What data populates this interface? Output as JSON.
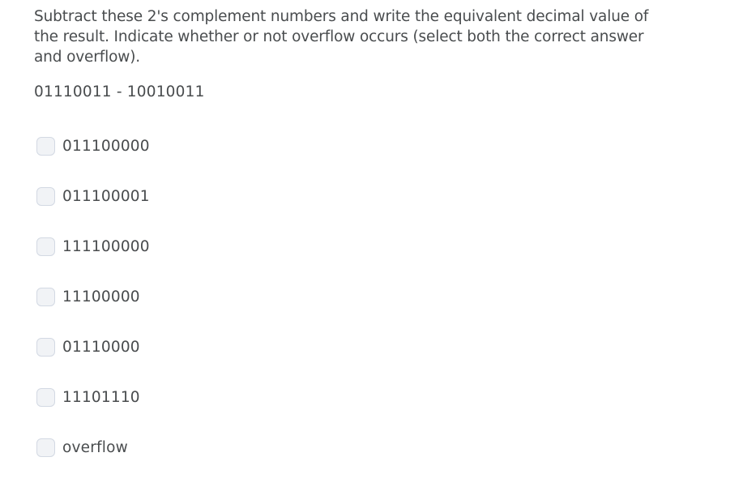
{
  "question": {
    "text": "Subtract these 2's complement numbers and write the equivalent decimal value of the result. Indicate whether or not overflow occurs (select both the correct answer and overflow).",
    "lines": [
      "Subtract these 2's complement numbers and write the equivalent decimal value of",
      "the result. Indicate whether or not overflow occurs (select both the correct answer",
      "and overflow)."
    ],
    "expression": "01110011 - 10010011"
  },
  "options": [
    {
      "label": "011100000",
      "checked": false,
      "icon": "checkbox-icon"
    },
    {
      "label": "011100001",
      "checked": false,
      "icon": "checkbox-icon"
    },
    {
      "label": "111100000",
      "checked": false,
      "icon": "checkbox-icon"
    },
    {
      "label": "11100000",
      "checked": false,
      "icon": "checkbox-icon"
    },
    {
      "label": "01110000",
      "checked": false,
      "icon": "checkbox-icon"
    },
    {
      "label": "11101110",
      "checked": false,
      "icon": "checkbox-icon"
    },
    {
      "label": "overflow",
      "checked": false,
      "icon": "checkbox-icon"
    }
  ],
  "colors": {
    "text": "#494c4e",
    "checkbox_fill": "#f1f3f6",
    "checkbox_border": "#d3d9e3"
  }
}
